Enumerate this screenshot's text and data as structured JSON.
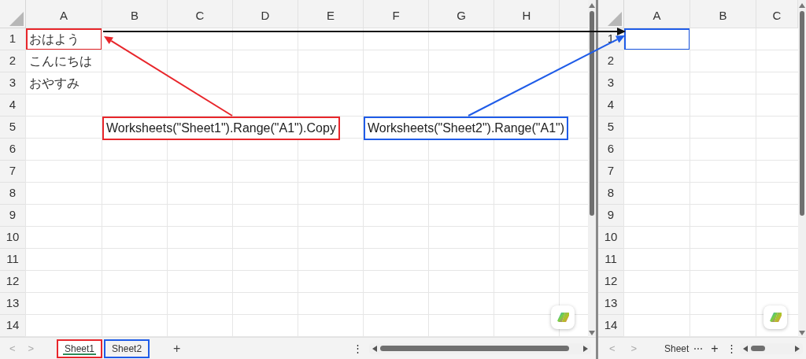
{
  "left_sheet": {
    "columns": [
      "A",
      "B",
      "C",
      "D",
      "E",
      "F",
      "G",
      "H"
    ],
    "rows": [
      {
        "label": "1",
        "a": "おはよう"
      },
      {
        "label": "2",
        "a": "こんにちは"
      },
      {
        "label": "3",
        "a": "おやすみ"
      },
      {
        "label": "4"
      },
      {
        "label": "5"
      },
      {
        "label": "6"
      },
      {
        "label": "7"
      },
      {
        "label": "8"
      },
      {
        "label": "9"
      },
      {
        "label": "10"
      },
      {
        "label": "11"
      },
      {
        "label": "12"
      },
      {
        "label": "13"
      },
      {
        "label": "14"
      }
    ],
    "tabs": [
      {
        "label": "Sheet1",
        "selected": true,
        "color": "#e8262b"
      },
      {
        "label": "Sheet2",
        "selected": false,
        "color": "#1f5ce8"
      }
    ],
    "add_tab": "+",
    "nav_prev": "<",
    "nav_next": ">",
    "more": "⋮"
  },
  "right_sheet": {
    "columns": [
      "A",
      "B",
      "C"
    ],
    "rows": [
      {
        "label": "1"
      },
      {
        "label": "2"
      },
      {
        "label": "3"
      },
      {
        "label": "4"
      },
      {
        "label": "5"
      },
      {
        "label": "6"
      },
      {
        "label": "7"
      },
      {
        "label": "8"
      },
      {
        "label": "9"
      },
      {
        "label": "10"
      },
      {
        "label": "11"
      },
      {
        "label": "12"
      },
      {
        "label": "13"
      },
      {
        "label": "14"
      }
    ],
    "tabs": [
      {
        "label": "Sheet",
        "selected": false
      }
    ],
    "tab_overflow": "⋯",
    "add_tab": "+",
    "nav_prev": "<",
    "nav_next": ">",
    "more": "⋮"
  },
  "annotations": [
    {
      "text": "Worksheets(\"Sheet1\").Range(\"A1\").Copy",
      "color": "#e8262b"
    },
    {
      "text": "Worksheets(\"Sheet2\").Range(\"A1\")",
      "color": "#1f5ce8"
    }
  ]
}
